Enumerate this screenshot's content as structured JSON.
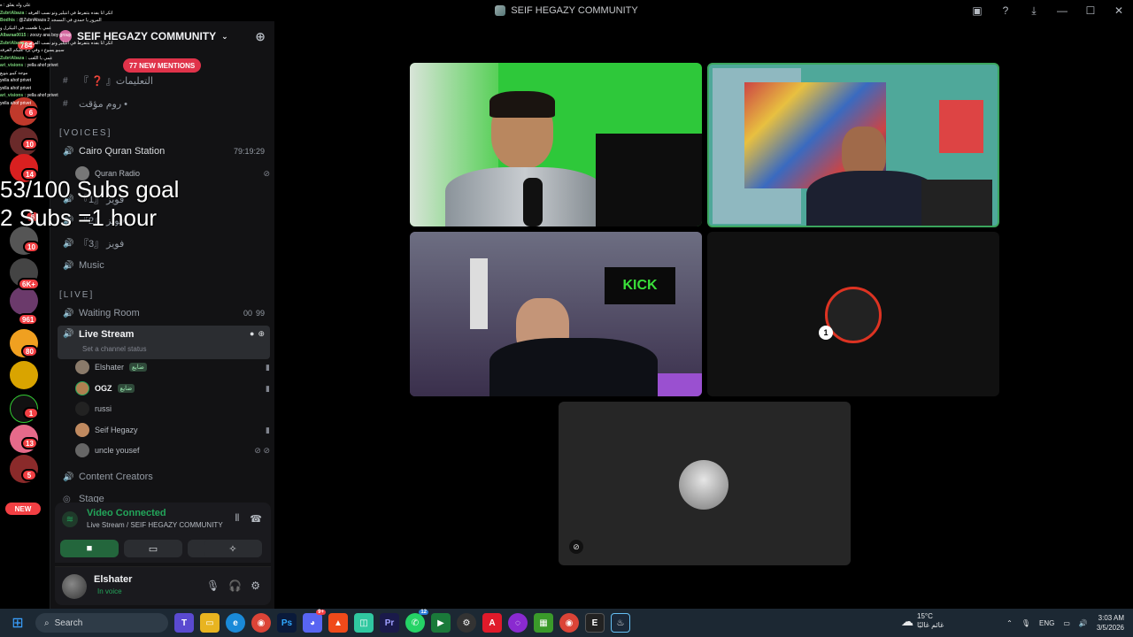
{
  "window": {
    "title": "SEIF HEGAZY COMMUNITY"
  },
  "overlay": {
    "goal_line1": "53/100 Subs goal",
    "goal_line2": "2 Subs =1 hour",
    "chat_lines": [
      {
        "user": "",
        "text": "على وله يقلق : ه"
      },
      {
        "user": "ZubriAbaza :",
        "text": "اتكر انا بفده بتتفرط في انتيلير وتو نسب الغرفه"
      },
      {
        "user": "Bodhis :",
        "text": "@ZubriAbaza 2 المرور يا حمدي في المسجد"
      },
      {
        "user": "",
        "text": "عمي يا طعمت في التيكرل و"
      },
      {
        "user": "Albaraa0015 :",
        "text": "zoozy ana boy group"
      },
      {
        "user": "ZubriAbaza :",
        "text": "اتكر انا بفده بتتفرط في انتيلير وتو نسب الغرفه"
      },
      {
        "user": "",
        "text": "سيبو يسوع د وفي يرد عليكم الغرفه"
      },
      {
        "user": "ZubriAbaza :",
        "text": "عمي يا اللعب"
      },
      {
        "user": "ari_visions :",
        "text": "yella ahof privet"
      },
      {
        "user": "",
        "text": "موجة كيبو بتويع"
      },
      {
        "user": "",
        "text": "yella ahof privet"
      },
      {
        "user": "",
        "text": "yella ahof privet"
      },
      {
        "user": "ari_visions :",
        "text": "yella ahof privet"
      },
      {
        "user": "",
        "text": "yella ahof privet"
      }
    ]
  },
  "rail": {
    "badges": [
      "784",
      "6",
      "10",
      "14",
      "6",
      "10",
      "6K+",
      "961",
      "80",
      "1",
      "13",
      "5"
    ],
    "new_label": "NEW"
  },
  "server": {
    "name": "SEIF HEGAZY COMMUNITY",
    "mentions": "77 NEW MENTIONS",
    "text_channels": [
      {
        "name": "『 ❓ 』التعليمات"
      },
      {
        "name": "روم مؤقت •"
      }
    ],
    "voices_category": "[VOICES]",
    "voice_channels": [
      {
        "name": "Cairo Quran Station",
        "extra": "79:19:29"
      },
      {
        "name": "فويز 『1』",
        "extra": ""
      },
      {
        "name": "فويز 『2』",
        "extra": ""
      },
      {
        "name": "فويز 『3』",
        "extra": ""
      },
      {
        "name": "Music",
        "extra": ""
      }
    ],
    "quran_user": "Quran Radio",
    "live_category": "[LIVE]",
    "waiting_room": {
      "name": "Waiting Room",
      "count_a": "00",
      "count_b": "99"
    },
    "live_stream": {
      "name": "Live Stream",
      "status": "Set a channel status"
    },
    "live_users": [
      {
        "name": "Elshater",
        "tag": "ضايع"
      },
      {
        "name": "OGZ",
        "tag": "ضايع"
      },
      {
        "name": "russi",
        "tag": ""
      },
      {
        "name": "Seif Hegazy",
        "tag": ""
      },
      {
        "name": "uncle yousef",
        "tag": ""
      }
    ],
    "content_creators": "Content Creators",
    "stage": "Stage"
  },
  "voice_panel": {
    "status": "Video Connected",
    "location": "Live Stream / SEIF HEGAZY COMMUNITY"
  },
  "user_panel": {
    "name": "Elshater",
    "status": "In voice"
  },
  "taskbar": {
    "search": "Search",
    "weather_temp": "15°C",
    "weather_desc": "غائم غالبًا",
    "lang": "ENG",
    "time": "3:03 AM",
    "date": "3/5/2026",
    "discord_badge": "9+",
    "whatsapp_badge": "12"
  },
  "colors": {
    "accent_green": "#23a55a",
    "mention_red": "#e0334a",
    "sidebar_bg": "#121214"
  }
}
